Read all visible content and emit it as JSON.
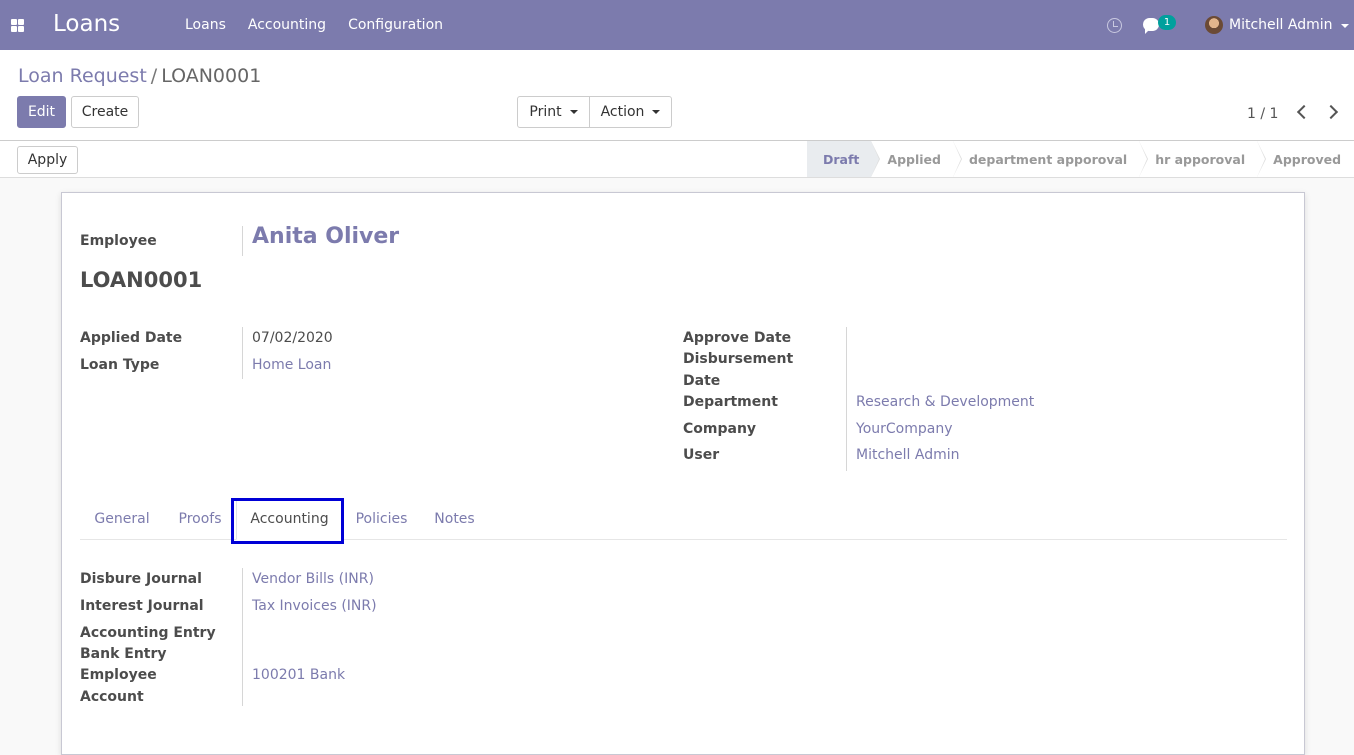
{
  "navbar": {
    "app_title": "Loans",
    "menu": [
      "Loans",
      "Accounting",
      "Configuration"
    ],
    "chat_count": "1",
    "user_name": "Mitchell Admin",
    "icons": [
      "apps-icon",
      "clock-icon",
      "chat-icon",
      "avatar",
      "chevron-down-icon"
    ]
  },
  "control_panel": {
    "breadcrumb_parent": "Loan Request",
    "breadcrumb_sep": "/",
    "breadcrumb_current": "LOAN0001",
    "edit_label": "Edit",
    "create_label": "Create",
    "print_label": "Print",
    "action_label": "Action",
    "pager": "1 / 1"
  },
  "statusbar": {
    "apply_label": "Apply",
    "stages": [
      "Draft",
      "Applied",
      "department apporoval",
      "hr apporoval",
      "Approved"
    ],
    "active_stage": "Draft"
  },
  "form": {
    "employee_label": "Employee",
    "employee_value": "Anita Oliver",
    "loan_ref": "LOAN0001",
    "left_fields": [
      {
        "label": "Applied Date",
        "value": "07/02/2020"
      },
      {
        "label": "Loan Type",
        "value": "Home Loan"
      }
    ],
    "right_fields": [
      {
        "label": "Approve Date",
        "value": ""
      },
      {
        "label": "Disbursement Date",
        "value": ""
      },
      {
        "label": "Department",
        "value": "Research & Development"
      },
      {
        "label": "Company",
        "value": "YourCompany"
      },
      {
        "label": "User",
        "value": "Mitchell Admin"
      }
    ],
    "right_label_lines": {
      "disbursement_1": "Disbursement",
      "disbursement_2": "Date"
    }
  },
  "tabs": [
    "General",
    "Proofs",
    "Accounting",
    "Policies",
    "Notes"
  ],
  "active_tab": "Accounting",
  "accounting": {
    "disburse_journal_label": "Disbure Journal",
    "disburse_journal_value": "Vendor Bills (INR)",
    "interest_journal_label": "Interest Journal",
    "interest_journal_value": "Tax Invoices (INR)",
    "accounting_entry_label": "Accounting Entry",
    "bank_entry_label": "Bank Entry",
    "employee_account_label_1": "Employee",
    "employee_account_label_2": "Account",
    "employee_account_value": "100201 Bank"
  },
  "colors": {
    "brand": "#7c7bad",
    "badge": "#00a09d",
    "highlight": "#0000d6"
  }
}
